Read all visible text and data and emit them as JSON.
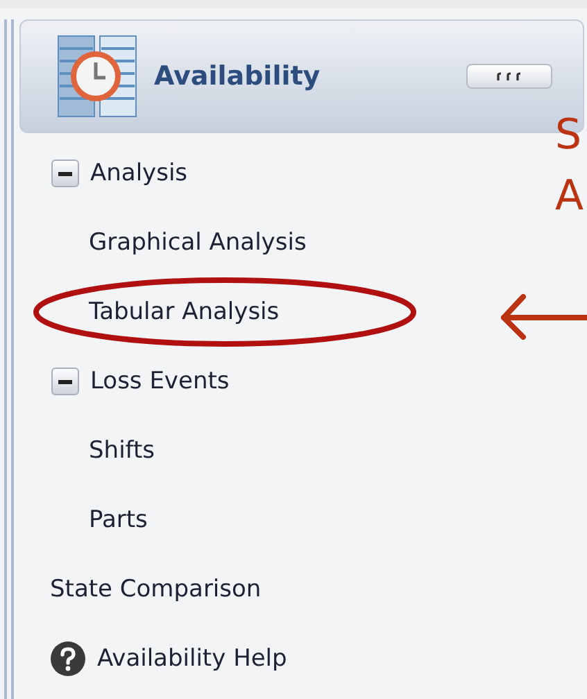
{
  "panel": {
    "title": "Availability"
  },
  "items": [
    {
      "label": "Analysis",
      "kind": "group",
      "expanded": true,
      "children": [
        {
          "label": "Graphical Analysis",
          "circled": false
        },
        {
          "label": "Tabular Analysis",
          "circled": true
        }
      ]
    },
    {
      "label": "Loss Events",
      "kind": "group",
      "expanded": true,
      "children": [
        {
          "label": "Shifts",
          "circled": false
        },
        {
          "label": "Parts",
          "circled": false
        }
      ]
    },
    {
      "label": "State Comparison",
      "kind": "link"
    },
    {
      "label": "Availability Help",
      "kind": "help"
    }
  ],
  "annotation": {
    "letters": [
      "S",
      "A"
    ]
  }
}
